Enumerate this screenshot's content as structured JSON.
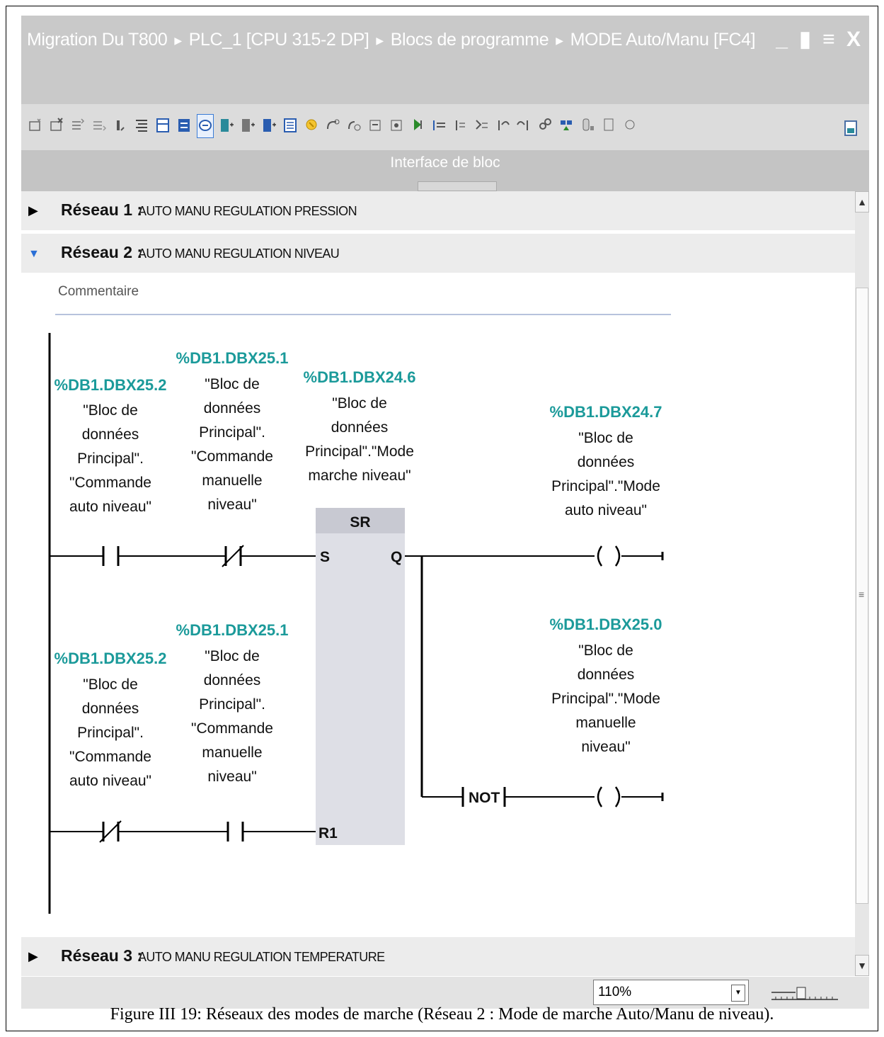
{
  "title_bar": {
    "crumbs": [
      "Migration Du T800",
      "PLC_1 [CPU 315-2 DP]",
      "Blocs de programme",
      "MODE Auto/Manu [FC4]"
    ],
    "window_controls": "_ ▮ ≡ X"
  },
  "toolbar": {
    "icons": [
      "insert-network-icon",
      "delete-network-icon",
      "insert-row-icon",
      "append-row-icon",
      "jump-icon",
      "expand-all-icon",
      "collapse-all-icon",
      "show-favorites-icon",
      "comment-icon",
      "absolute-operands-icon",
      "show-operand-icon",
      "symbol-info-icon",
      "network-view-icon",
      "call-update-icon",
      "insert-empty-box-icon",
      "open-branch-icon",
      "close-branch-icon",
      "monitor-icon",
      "set-icon",
      "reset-icon",
      "ladder-to-icon",
      "toggle-icon",
      "previous-error-icon",
      "next-error-icon",
      "program-status-icon",
      "call-overview-icon",
      "watch-icon",
      "modify-icon",
      "diagnostics-icon"
    ],
    "selected_index": 8
  },
  "interface_bar": {
    "label": "Interface de bloc"
  },
  "networks": [
    {
      "number": "Réseau 1 :",
      "title": "AUTO MANU REGULATION PRESSION",
      "expanded": false
    },
    {
      "number": "Réseau 2 :",
      "title": "AUTO MANU REGULATION NIVEAU",
      "expanded": true
    },
    {
      "number": "Réseau 3 :",
      "title": "AUTO MANU REGULATION TEMPERATURE",
      "expanded": false
    }
  ],
  "network2": {
    "comment_placeholder": "Commentaire",
    "row1": {
      "contact1": {
        "address": "%DB1.DBX25.2",
        "symbol": [
          "\"Bloc de",
          "données",
          "Principal\".",
          "\"Commande",
          "auto niveau\""
        ],
        "type": "NO"
      },
      "contact2": {
        "address": "%DB1.DBX25.1",
        "symbol": [
          "\"Bloc de",
          "données",
          "Principal\".",
          "\"Commande",
          "manuelle",
          "niveau\""
        ],
        "type": "NC"
      },
      "sr": {
        "address": "%DB1.DBX24.6",
        "symbol": [
          "\"Bloc de",
          "données",
          "Principal\".\"Mode",
          "marche niveau\""
        ],
        "name": "SR",
        "pin_s": "S",
        "pin_q": "Q",
        "pin_r": "R1"
      },
      "coil": {
        "address": "%DB1.DBX24.7",
        "symbol": [
          "\"Bloc de",
          "données",
          "Principal\".\"Mode",
          "auto niveau\""
        ]
      }
    },
    "row2": {
      "contact1": {
        "address": "%DB1.DBX25.2",
        "symbol": [
          "\"Bloc de",
          "données",
          "Principal\".",
          "\"Commande",
          "auto niveau\""
        ],
        "type": "NC"
      },
      "contact2": {
        "address": "%DB1.DBX25.1",
        "symbol": [
          "\"Bloc de",
          "données",
          "Principal\".",
          "\"Commande",
          "manuelle",
          "niveau\""
        ],
        "type": "NO"
      },
      "not_label": "NOT",
      "coil": {
        "address": "%DB1.DBX25.0",
        "symbol": [
          "\"Bloc de",
          "données",
          "Principal\".\"Mode",
          "manuelle",
          "niveau\""
        ]
      }
    }
  },
  "zoom": {
    "value": "110%"
  },
  "caption": "Figure III 19: Réseaux des modes de marche (Réseau 2 : Mode de marche Auto/Manu de niveau)."
}
